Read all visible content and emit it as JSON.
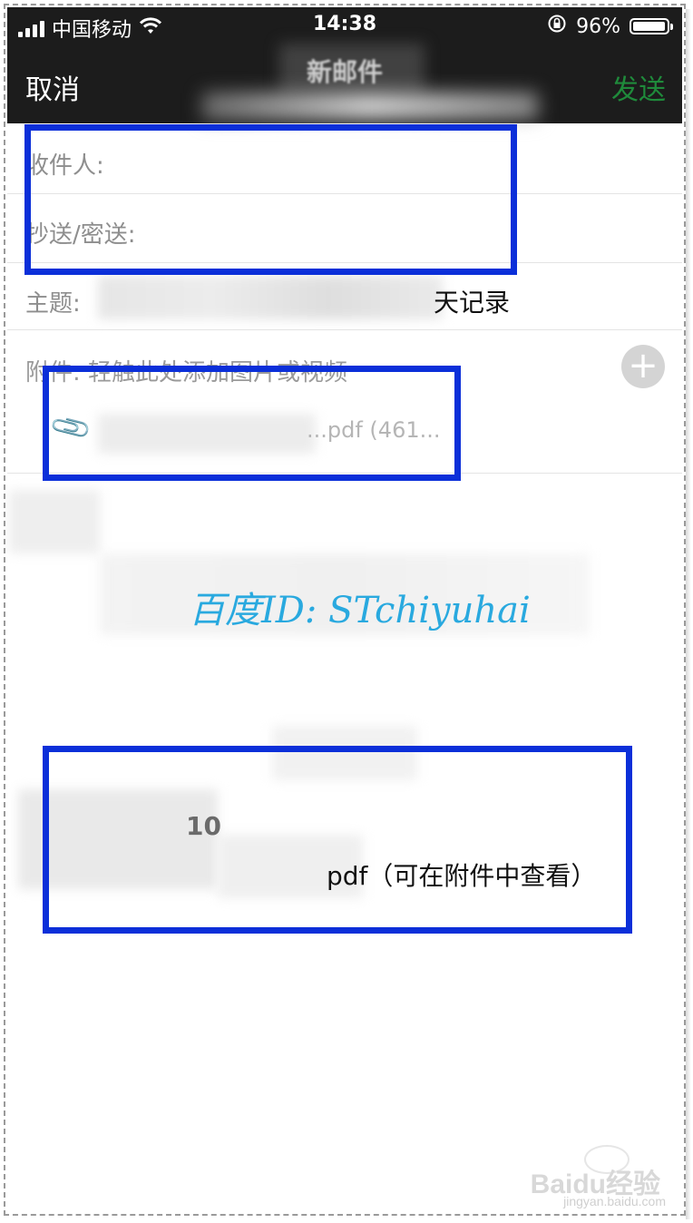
{
  "status_bar": {
    "carrier": "中国移动",
    "time": "14:38",
    "battery": "96%",
    "battery_level": 0.96
  },
  "nav": {
    "cancel_label": "取消",
    "title": "新邮件",
    "send_label": "发送"
  },
  "form": {
    "to_label": "收件人:",
    "cc_label": "抄送/密送:",
    "subject_label": "主题:",
    "subject_value_visible": "天记录",
    "attachment_label": "附件: 轻触此处添加图片或视频",
    "attachment_file": "...pdf (461...",
    "add_icon": "plus-circle-icon",
    "clip_icon": "paperclip-icon"
  },
  "body": {
    "line1_visible": "10",
    "line2_visible": "pdf（可在附件中查看）"
  },
  "watermark": {
    "text": "百度ID: STchiyuhai",
    "color": "#29a9df"
  },
  "baidu_logo": {
    "text": "Baidu经验",
    "url": "jingyan.baidu.com"
  },
  "colors": {
    "highlight": "#0b2fd9",
    "send": "#1f8a3b",
    "bar": "#1c1c1c"
  }
}
